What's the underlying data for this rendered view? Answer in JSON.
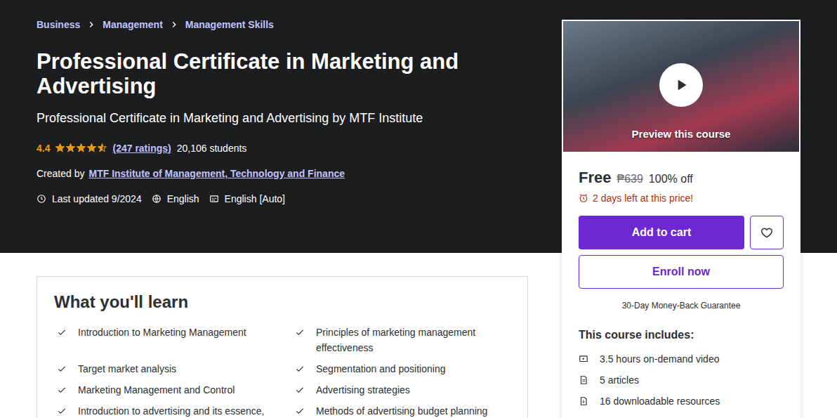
{
  "breadcrumb": [
    "Business",
    "Management",
    "Management Skills"
  ],
  "course": {
    "title": "Professional Certificate in Marketing and Advertising",
    "subtitle": "Professional Certificate in Marketing and Advertising by MTF Institute",
    "rating": "4.4",
    "stars": 4.5,
    "ratings_link": "(247 ratings)",
    "students": "20,106 students",
    "created_by_label": "Created by",
    "author": "MTF Institute of Management, Technology and Finance",
    "last_updated": "Last updated 9/2024",
    "language": "English",
    "captions": "English [Auto]"
  },
  "sidebar": {
    "preview_label": "Preview this course",
    "price": "Free",
    "original_price": "₱639",
    "discount": "100% off",
    "deadline": "2 days left at this price!",
    "add_to_cart": "Add to cart",
    "enroll": "Enroll now",
    "guarantee": "30-Day Money-Back Guarantee",
    "includes_title": "This course includes:",
    "includes": [
      {
        "text": "3.5 hours on-demand video",
        "kind": "video"
      },
      {
        "text": "5 articles",
        "kind": "article"
      },
      {
        "text": "16 downloadable resources",
        "kind": "download"
      }
    ]
  },
  "learn": {
    "title": "What you'll learn",
    "items": [
      "Introduction to Marketing Management",
      "Principles of marketing management effectiveness",
      "Target market analysis",
      "Segmentation and positioning",
      "Marketing Management and Control",
      "Advertising strategies",
      "Introduction to advertising and its essence,",
      "Methods of advertising budget planning"
    ]
  }
}
